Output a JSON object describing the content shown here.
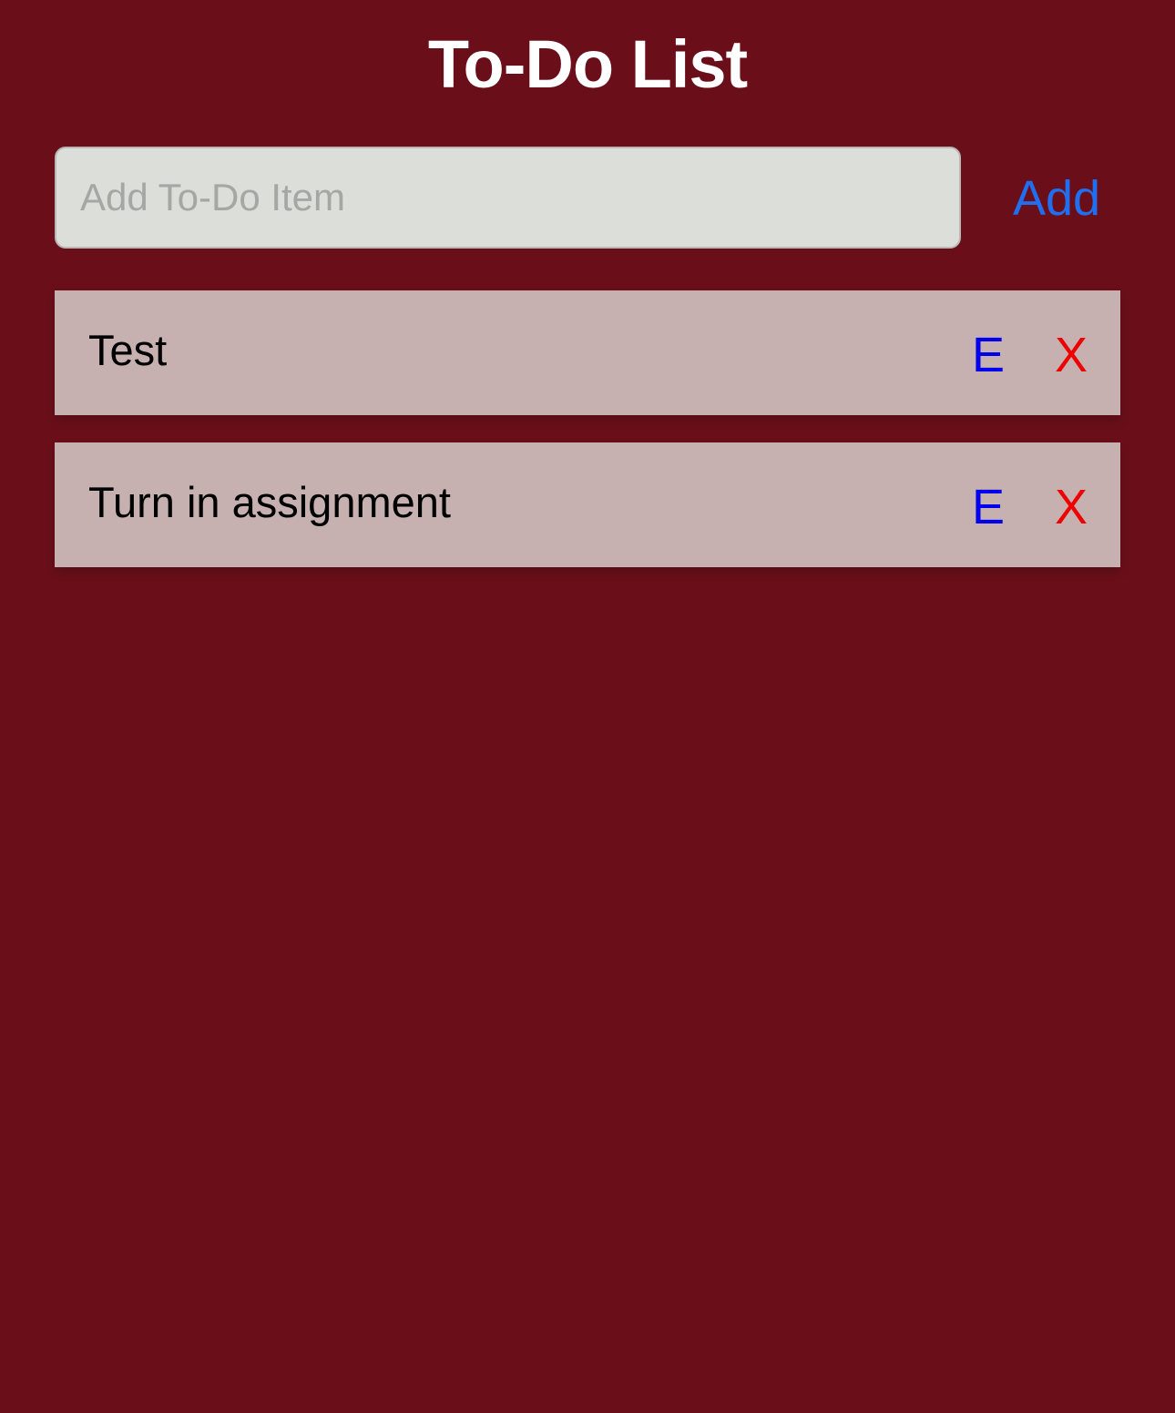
{
  "header": {
    "title": "To-Do List"
  },
  "add_form": {
    "placeholder": "Add To-Do Item",
    "value": "",
    "add_label": "Add"
  },
  "items": [
    {
      "text": "Test",
      "edit_label": "E",
      "delete_label": "X"
    },
    {
      "text": "Turn in assignment",
      "edit_label": "E",
      "delete_label": "X"
    }
  ],
  "colors": {
    "background": "#6a0f1a",
    "item_background": "#c6b0b0",
    "input_background": "#dcded9",
    "add_button": "#1f6ff0",
    "edit_button": "#0000ee",
    "delete_button": "#ee0000"
  }
}
